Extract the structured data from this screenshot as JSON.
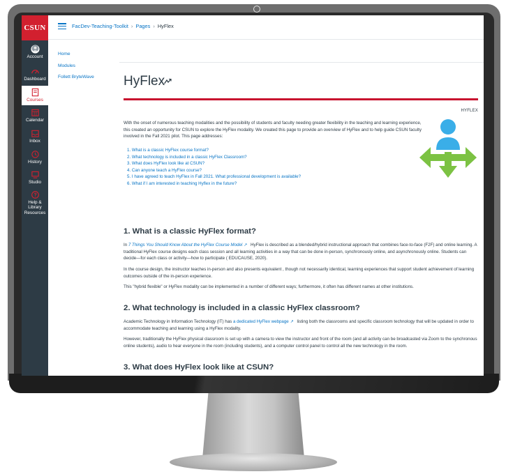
{
  "global_nav": {
    "logo": "CSUN",
    "items": [
      {
        "label": "Account",
        "icon": "avatar-icon"
      },
      {
        "label": "Dashboard",
        "icon": "dashboard-icon"
      },
      {
        "label": "Courses",
        "icon": "courses-icon",
        "active": true
      },
      {
        "label": "Calendar",
        "icon": "calendar-icon"
      },
      {
        "label": "Inbox",
        "icon": "inbox-icon"
      },
      {
        "label": "History",
        "icon": "history-icon"
      },
      {
        "label": "Studio",
        "icon": "studio-icon"
      },
      {
        "label": "Help & Library Resources",
        "icon": "help-icon"
      }
    ]
  },
  "breadcrumb": {
    "course": "FacDev-Teaching-Toolkit",
    "sep": "›",
    "section": "Pages",
    "current": "HyFlex"
  },
  "course_nav": [
    "Home",
    "Modules",
    "Follett BryteWave"
  ],
  "page": {
    "title": "HyFlex",
    "label": "HYFLEX",
    "intro": "With the onset of numerous teaching modalities and the possibility of students and faculty needing greater flexibility in the teaching and learning experience, this created an opportunity for CSUN to explore the HyFlex modality. We created this page to provide an overview of HyFlex and to help guide CSUN faculty involved in the Fall 2021 pilot. This page addresses:",
    "toc": [
      "1. What is a classic HyFlex course format?",
      "2. What technology is included in a classic HyFlex Classroom?",
      "3. What does HyFlex look like at CSUN?",
      "4. Can anyone teach a HyFlex course?",
      "5. I have agreed to teach HyFlex in Fall 2021. What professional development is available?",
      "6. What if I am interested in teaching Hyflex in the future?"
    ],
    "s1": {
      "heading": "1. What is a classic HyFlex format?",
      "p1_pre": "In ",
      "p1_link": "7 Things You Should Know About the HyFlex Course Model",
      "p1_post": " HyFlex is described as a blended/hybrid instructional approach that combines face-to-face (F2F) and online learning. A traditional HyFlex course designs each class session and all learning activities in a way that can be done in-person, synchronously online, and asynchronously online. Students can decide—for each class or activity—how to participate ( EDUCAUSE, 2020).",
      "p2": "In the course design, the instructor teaches in-person and also presents equivalent , though not necessarily identical, learning experiences that support student achievement of learning outcomes outside of the in-person experience.",
      "p3": "This \"hybrid flexible\" or HyFlex modality can be implemented in a number of different ways; furthermore, it often has different names at other institutions."
    },
    "s2": {
      "heading": "2. What technology is included in a classic HyFlex classroom?",
      "p1_pre": "Academic Technology in Information Technology (IT) has ",
      "p1_link": "a dedicated HyFlex webpage",
      "p1_post": " listing both the classrooms and specific classroom technology that will be updated in order to accommodate teaching and learning using a HyFlex modality.",
      "p2": "However, traditionally the HyFlex physical classroom is set up with a camera to view the instructor and front of the room (and all activity can be broadcasted via Zoom to the synchronous online students), audio to hear everyone in the room (including students), and a computer control panel to control all the new technology in the room."
    },
    "s3": {
      "heading": "3. What does HyFlex look like at CSUN?"
    }
  },
  "colors": {
    "csun_red": "#d2202f",
    "nav_dark": "#2d3b45",
    "link_blue": "#0774c5",
    "hero_blue": "#3aaee8",
    "hero_green": "#7cc243"
  }
}
